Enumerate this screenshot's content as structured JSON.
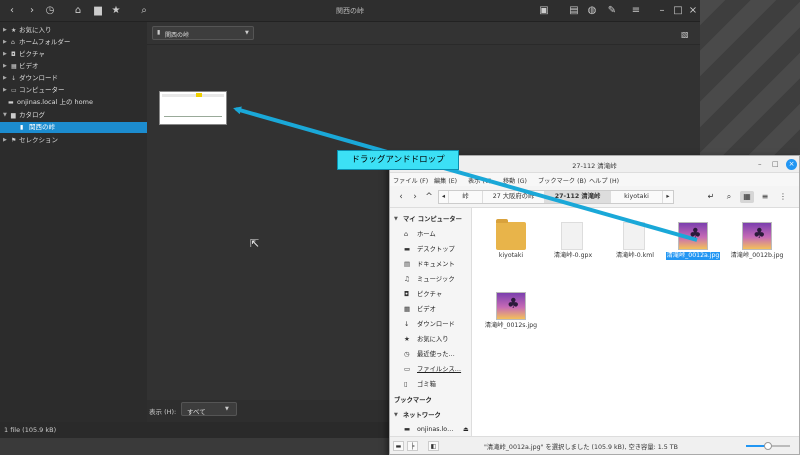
{
  "main_window": {
    "title": "関西の峠",
    "sidebar": [
      {
        "label": "お気に入り",
        "icon": "star-icon",
        "arrow": true
      },
      {
        "label": "ホームフォルダー",
        "icon": "home-icon",
        "arrow": true
      },
      {
        "label": "ピクチャ",
        "icon": "camera-icon",
        "arrow": true
      },
      {
        "label": "ビデオ",
        "icon": "film-icon",
        "arrow": true
      },
      {
        "label": "ダウンロード",
        "icon": "download-icon",
        "arrow": true
      },
      {
        "label": "コンピューター",
        "icon": "computer-icon",
        "arrow": true
      },
      {
        "label": "onjinas.local 上の home",
        "icon": "folder-icon",
        "arrow": false
      },
      {
        "label": "カタログ",
        "icon": "catalog-icon",
        "arrow": true
      },
      {
        "label": "関西の峠",
        "icon": "catalog-item-icon",
        "arrow": false,
        "selected": true
      },
      {
        "label": "セレクション",
        "icon": "flag-icon",
        "arrow": true
      }
    ],
    "location_label": "関西の峠",
    "filter_label": "表示 (H):",
    "filter_value": "すべて",
    "status_text": "1 file (105.9 kB)"
  },
  "callout": {
    "text": "ドラッグアンドドロップ"
  },
  "file_manager": {
    "title": "27-112 清滝峠",
    "menu": [
      "ファイル (F)",
      "編集 (E)",
      "表示 (V)",
      "移動 (G)",
      "ブックマーク (B)",
      "ヘルプ (H)"
    ],
    "breadcrumbs": [
      "峠",
      "27 大阪府の峠",
      "27-112 清滝峠",
      "kiyotaki"
    ],
    "sidebar": [
      {
        "label": "マイ コンピューター",
        "header": true
      },
      {
        "label": "ホーム",
        "icon": "home-icon"
      },
      {
        "label": "デスクトップ",
        "icon": "desktop-icon"
      },
      {
        "label": "ドキュメント",
        "icon": "document-icon"
      },
      {
        "label": "ミュージック",
        "icon": "music-icon"
      },
      {
        "label": "ピクチャ",
        "icon": "camera-icon"
      },
      {
        "label": "ビデオ",
        "icon": "film-icon"
      },
      {
        "label": "ダウンロード",
        "icon": "download-icon"
      },
      {
        "label": "お気に入り",
        "icon": "star-icon"
      },
      {
        "label": "最近使った…",
        "icon": "recent-icon"
      },
      {
        "label": "ファイルシス…",
        "icon": "drive-icon"
      },
      {
        "label": "ゴミ箱",
        "icon": "trash-icon"
      },
      {
        "label": "ブックマーク",
        "header": true,
        "noarrow": true
      },
      {
        "label": "ネットワーク",
        "header": true
      },
      {
        "label": "onjinas.lo…",
        "icon": "network-drive-icon",
        "eject": true
      }
    ],
    "files": [
      {
        "name": "kiyotaki",
        "type": "folder"
      },
      {
        "name": "清滝峠-0.gpx",
        "type": "doc"
      },
      {
        "name": "清滝峠-0.kml",
        "type": "doc"
      },
      {
        "name": "清滝峠_0012a.jpg",
        "type": "image",
        "selected": true
      },
      {
        "name": "清滝峠_0012b.jpg",
        "type": "image"
      },
      {
        "name": "清滝峠_0012s.jpg",
        "type": "image"
      }
    ],
    "status_text": "\"清滝峠_0012a.jpg\" を選択しました (105.9 kB), 空き容量: 1.5 TB",
    "zoom_level": 0.5
  }
}
